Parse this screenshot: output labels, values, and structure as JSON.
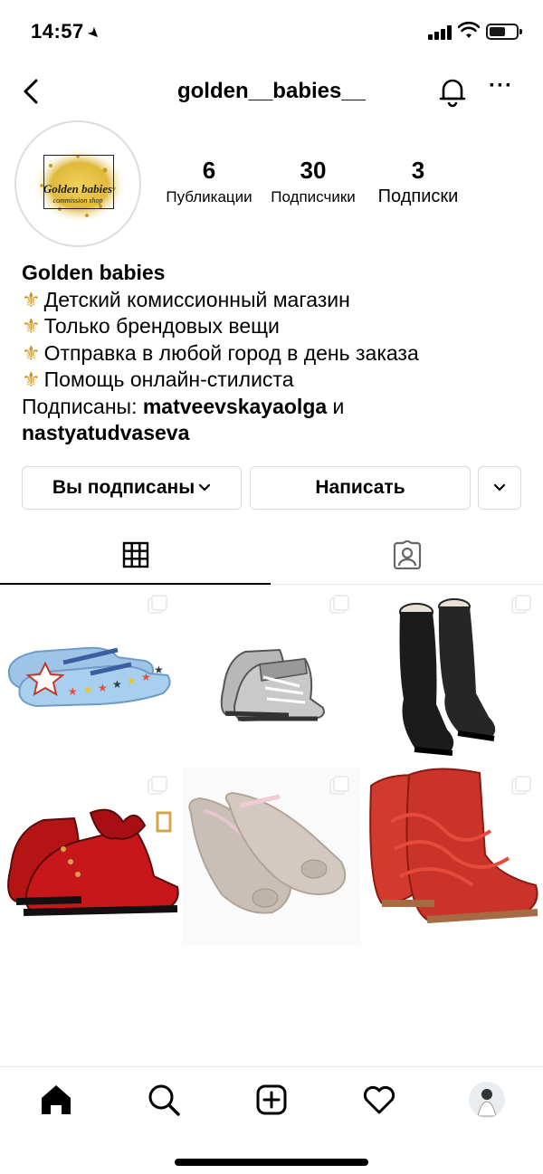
{
  "status_bar": {
    "time": "14:57",
    "battery_level": 0.6
  },
  "header": {
    "title": "golden__babies__",
    "more_label": "···"
  },
  "avatar": {
    "logo_name": "Golden babies",
    "logo_subtitle": "commission shop"
  },
  "stats": [
    {
      "value": "6",
      "label": "Публикации"
    },
    {
      "value": "30",
      "label": "Подписчики"
    },
    {
      "value": "3",
      "label": "Подписки"
    }
  ],
  "bio": {
    "name": "Golden babies",
    "bullet": "⚜",
    "lines": [
      "Детский комиссионный магазин",
      "Только брендовых вещи",
      "Отправка в любой город в день заказа",
      "Помощь онлайн-стилиста"
    ],
    "followed_by_prefix": "Подписаны: ",
    "followed_by_user1": "matveevskayaolga",
    "followed_by_and": " и",
    "followed_by_user2": "nastyatudvaseva"
  },
  "buttons": {
    "following": "Вы подписаны",
    "message": "Написать"
  },
  "posts": [
    {
      "item": "blue-star-shoes"
    },
    {
      "item": "silver-boots"
    },
    {
      "item": "black-tall-boots"
    },
    {
      "item": "red-patent-boots"
    },
    {
      "item": "pink-glitter-flats"
    },
    {
      "item": "red-lace-up-boots"
    }
  ],
  "colors": {
    "accent_gold": "#c9982a",
    "border": "#dbdbdb"
  }
}
